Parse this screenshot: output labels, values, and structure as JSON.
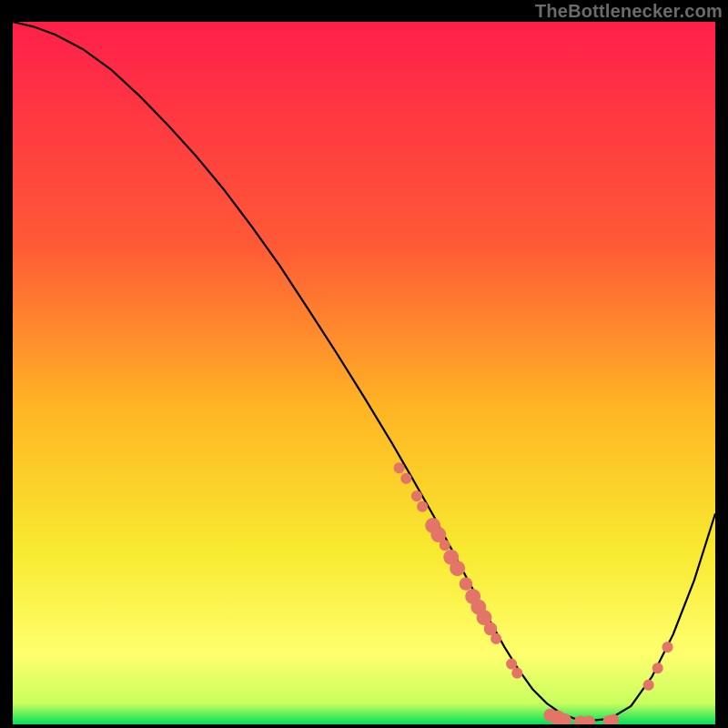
{
  "watermark": "TheBottlenecker.com",
  "colors": {
    "gradient_top": "#ff1f4a",
    "gradient_mid1": "#ff5a36",
    "gradient_mid2": "#ffb524",
    "gradient_mid3": "#f8e92e",
    "gradient_mid4": "#ffff6e",
    "gradient_bottom": "#00e05a",
    "curve": "#000000",
    "marker": "#e37468",
    "background": "#000000"
  },
  "chart_data": {
    "type": "line",
    "title": "",
    "xlabel": "",
    "ylabel": "",
    "xlim": [
      0,
      100
    ],
    "ylim": [
      0,
      100
    ],
    "curve": {
      "name": "bottleneck-curve",
      "x": [
        0,
        3,
        6,
        10,
        14,
        18,
        22,
        26,
        30,
        34,
        38,
        42,
        46,
        50,
        54,
        57,
        60,
        62,
        64,
        66,
        68,
        70,
        72,
        74,
        76,
        78,
        80,
        82,
        85,
        88,
        91,
        94,
        97,
        100
      ],
      "y": [
        100,
        99.3,
        98.2,
        96.1,
        93.2,
        89.5,
        85.4,
        81.0,
        76.2,
        70.9,
        65.3,
        59.2,
        53.0,
        46.6,
        40.0,
        34.8,
        29.5,
        25.8,
        22.0,
        18.3,
        14.6,
        11.0,
        7.8,
        5.0,
        3.0,
        1.6,
        0.8,
        0.5,
        0.8,
        2.6,
        6.8,
        12.8,
        20.5,
        30.0
      ]
    },
    "markers": [
      {
        "x": 55,
        "y": 36.5,
        "r": 1.0
      },
      {
        "x": 56,
        "y": 35.0,
        "r": 1.0
      },
      {
        "x": 57.5,
        "y": 32.5,
        "r": 1.0
      },
      {
        "x": 58.3,
        "y": 31.0,
        "r": 1.0
      },
      {
        "x": 59.8,
        "y": 28.3,
        "r": 1.4
      },
      {
        "x": 60.6,
        "y": 27.0,
        "r": 1.4
      },
      {
        "x": 61.5,
        "y": 25.5,
        "r": 1.0
      },
      {
        "x": 62.4,
        "y": 23.8,
        "r": 1.4
      },
      {
        "x": 63.3,
        "y": 22.2,
        "r": 1.4
      },
      {
        "x": 64.5,
        "y": 20.0,
        "r": 1.2
      },
      {
        "x": 65.5,
        "y": 18.2,
        "r": 1.4
      },
      {
        "x": 66.3,
        "y": 16.7,
        "r": 1.4
      },
      {
        "x": 67.1,
        "y": 15.2,
        "r": 1.4
      },
      {
        "x": 68.0,
        "y": 13.6,
        "r": 1.2
      },
      {
        "x": 68.8,
        "y": 12.2,
        "r": 1.0
      },
      {
        "x": 71.0,
        "y": 8.6,
        "r": 1.0
      },
      {
        "x": 71.8,
        "y": 7.3,
        "r": 1.0
      },
      {
        "x": 76.5,
        "y": 1.3,
        "r": 1.2
      },
      {
        "x": 77.6,
        "y": 0.9,
        "r": 1.4
      },
      {
        "x": 78.6,
        "y": 0.6,
        "r": 1.2
      },
      {
        "x": 80.8,
        "y": 0.3,
        "r": 1.2
      },
      {
        "x": 82.0,
        "y": 0.3,
        "r": 1.2
      },
      {
        "x": 84.8,
        "y": 0.5,
        "r": 1.0
      },
      {
        "x": 85.5,
        "y": 0.7,
        "r": 1.0
      },
      {
        "x": 90.5,
        "y": 5.6,
        "r": 1.0
      },
      {
        "x": 91.8,
        "y": 8.0,
        "r": 1.0
      },
      {
        "x": 93.2,
        "y": 11.0,
        "r": 1.0
      }
    ]
  }
}
